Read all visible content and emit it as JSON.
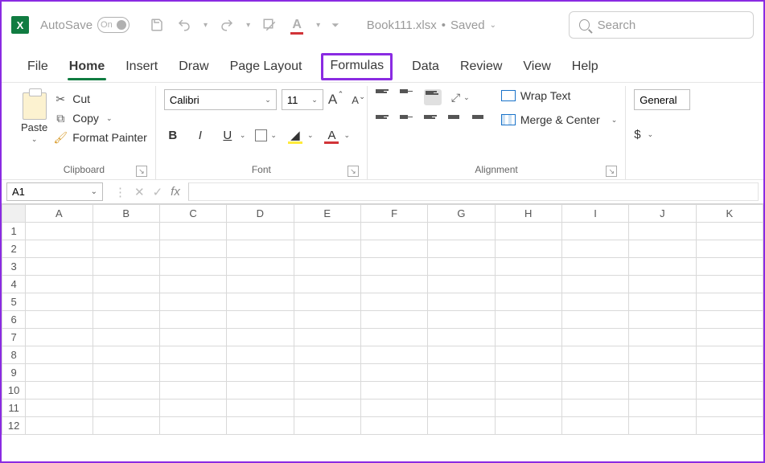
{
  "title": {
    "autosave": "AutoSave",
    "autosave_state": "On",
    "doc": "Book111.xlsx",
    "status": "Saved",
    "search_placeholder": "Search"
  },
  "tabs": {
    "file": "File",
    "home": "Home",
    "insert": "Insert",
    "draw": "Draw",
    "page_layout": "Page Layout",
    "formulas": "Formulas",
    "data": "Data",
    "review": "Review",
    "view": "View",
    "help": "Help"
  },
  "ribbon": {
    "clipboard": {
      "paste": "Paste",
      "cut": "Cut",
      "copy": "Copy",
      "format_painter": "Format Painter",
      "label": "Clipboard"
    },
    "font": {
      "name": "Calibri",
      "size": "11",
      "bold": "B",
      "italic": "I",
      "underline": "U",
      "label": "Font"
    },
    "alignment": {
      "wrap": "Wrap Text",
      "merge": "Merge & Center",
      "label": "Alignment"
    },
    "number": {
      "format": "General",
      "currency": "$"
    }
  },
  "formula_bar": {
    "cell_ref": "A1",
    "formula": ""
  },
  "grid": {
    "cols": [
      "A",
      "B",
      "C",
      "D",
      "E",
      "F",
      "G",
      "H",
      "I",
      "J",
      "K"
    ],
    "rows": [
      "1",
      "2",
      "3",
      "4",
      "5",
      "6",
      "7",
      "8",
      "9",
      "10",
      "11",
      "12"
    ]
  }
}
